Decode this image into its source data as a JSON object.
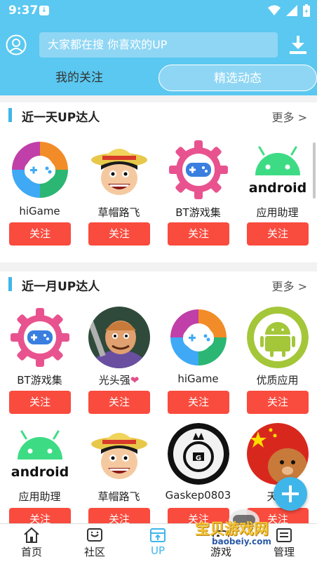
{
  "status_bar": {
    "time": "9:37"
  },
  "header": {
    "search_placeholder": "大家都在搜  你喜欢的UP",
    "tabs": [
      {
        "label": "我的关注",
        "active": false
      },
      {
        "label": "精选动态",
        "active": true
      }
    ]
  },
  "sections": [
    {
      "title": "近一天UP达人",
      "more": "更多 >",
      "items": [
        {
          "name": "hiGame",
          "icon": "higame-icon",
          "follow": "关注"
        },
        {
          "name": "草帽路飞",
          "icon": "luffy-avatar",
          "follow": "关注"
        },
        {
          "name": "BT游戏集",
          "icon": "bt-gear-icon",
          "follow": "关注"
        },
        {
          "name": "应用助理",
          "icon": "android-icon",
          "follow": "关注"
        }
      ]
    },
    {
      "title": "近一月UP达人",
      "more": "更多 >",
      "items": [
        {
          "name": "BT游戏集",
          "icon": "bt-gear-icon",
          "follow": "关注"
        },
        {
          "name": "光头强",
          "icon": "logger-avatar",
          "follow": "关注"
        },
        {
          "name": "hiGame",
          "icon": "higame-icon",
          "follow": "关注"
        },
        {
          "name": "优质应用",
          "icon": "android-green-icon",
          "follow": "关注"
        },
        {
          "name": "应用助理",
          "icon": "android-icon",
          "follow": "关注"
        },
        {
          "name": "草帽路飞",
          "icon": "luffy-avatar",
          "follow": "关注"
        },
        {
          "name": "Gaskep0803",
          "icon": "gaskep-avatar",
          "follow": "关注"
        },
        {
          "name": "天空",
          "icon": "flag-bear-avatar",
          "follow": "关注"
        }
      ]
    }
  ],
  "bottom_nav": [
    {
      "label": "首页",
      "icon": "home-icon",
      "active": false
    },
    {
      "label": "社区",
      "icon": "community-icon",
      "active": false
    },
    {
      "label": "UP",
      "icon": "up-icon",
      "active": true
    },
    {
      "label": "游戏",
      "icon": "game-icon",
      "active": false
    },
    {
      "label": "管理",
      "icon": "manage-icon",
      "active": false
    }
  ],
  "watermark": {
    "text": "宝贝游戏网",
    "url": "baobeiy.com"
  },
  "colors": {
    "primary": "#5ac8f0",
    "accent": "#3fb6ea",
    "follow_button": "#f94b3e"
  }
}
